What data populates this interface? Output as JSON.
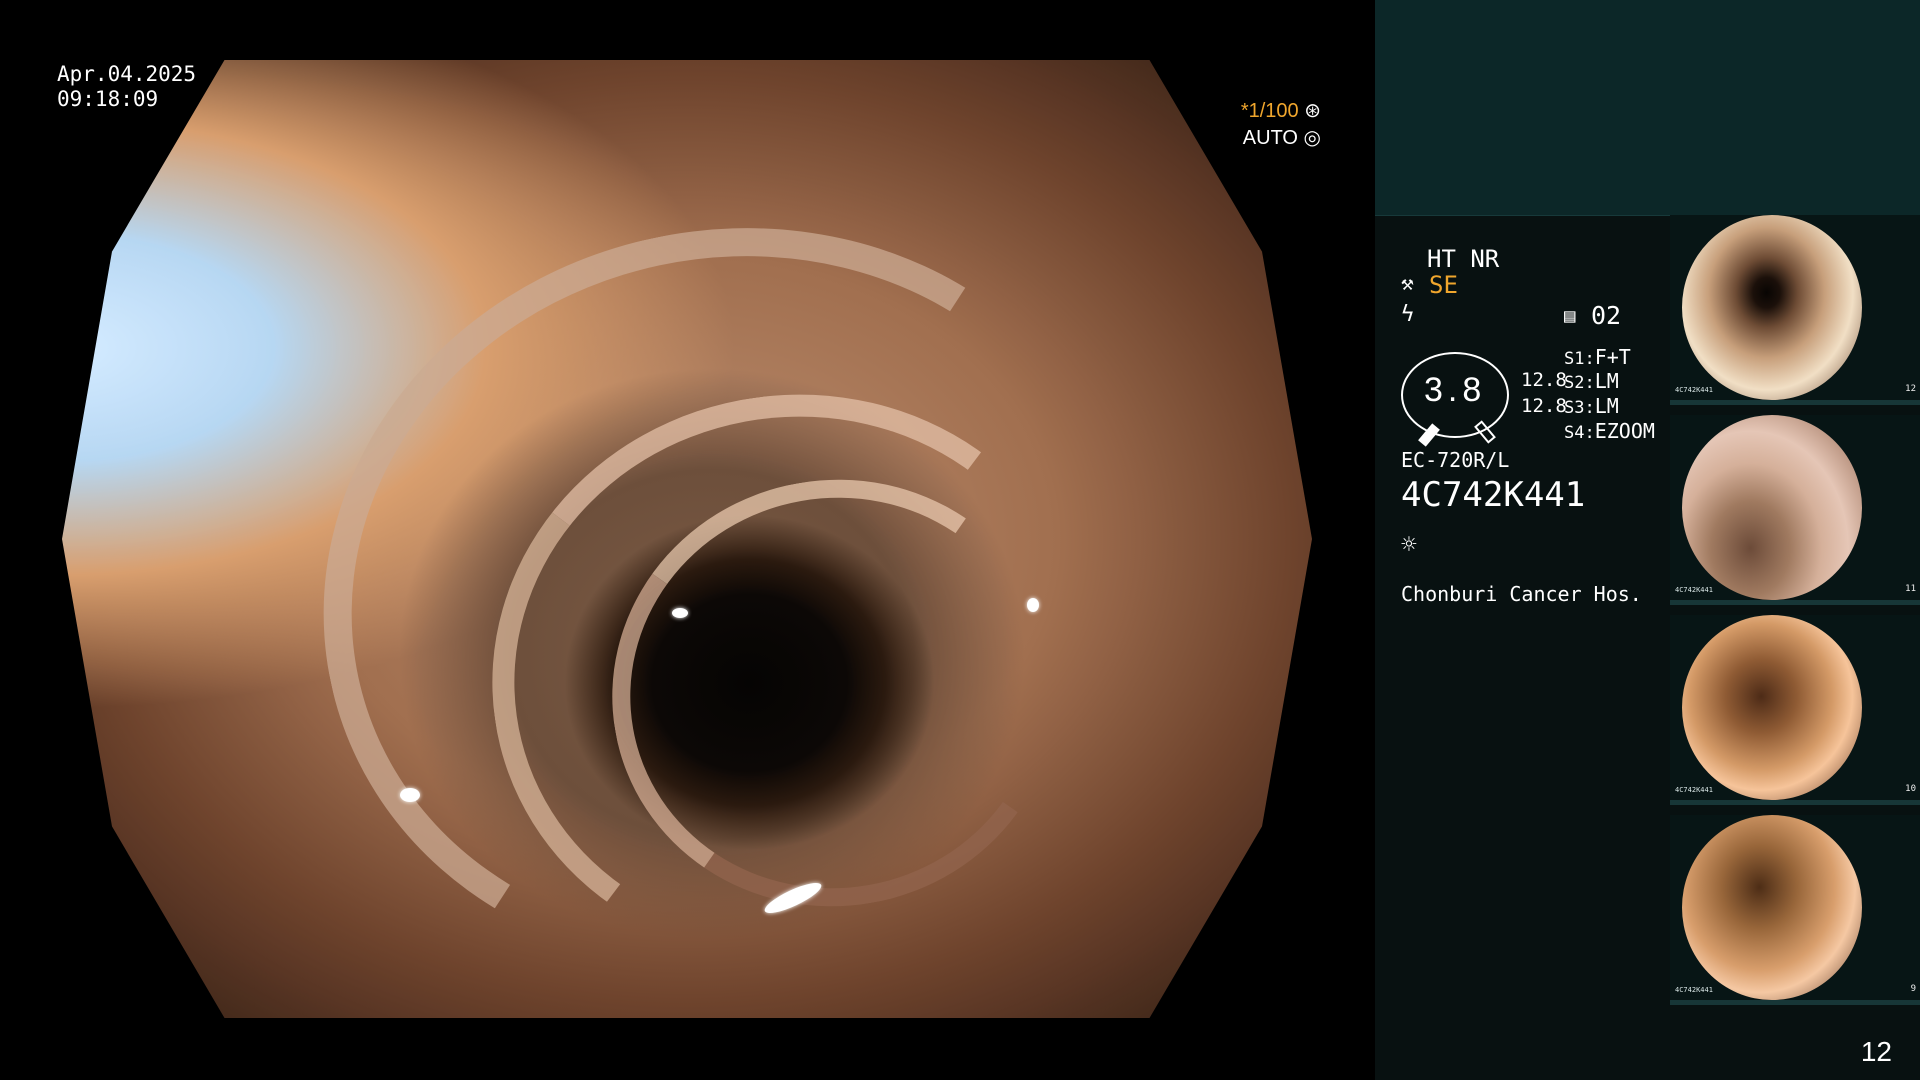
{
  "main": {
    "date": "Apr.04.2025",
    "time": "09:18:09",
    "shutter": "*1/100",
    "mode": "AUTO"
  },
  "info": {
    "header": "HT NR",
    "se": "SE",
    "mark_text": "02",
    "zoom": "3.8",
    "values": [
      "12.8",
      "12.8"
    ],
    "settings": [
      {
        "key": "S1:",
        "value": "F+T"
      },
      {
        "key": "S2:",
        "value": "LM"
      },
      {
        "key": "S3:",
        "value": "LM"
      },
      {
        "key": "S4:",
        "value": "EZOOM"
      }
    ],
    "model": "EC-720R/L",
    "id": "4C742K441",
    "location": "Chonburi Cancer Hos."
  },
  "thumbs": [
    {
      "id": "4C742K441",
      "number": "12"
    },
    {
      "id": "4C742K441",
      "number": "11"
    },
    {
      "id": "4C742K441",
      "number": "10"
    },
    {
      "id": "4C742K441",
      "number": "9"
    }
  ],
  "page_number": "12",
  "icons": [
    "wrench-icon",
    "flash-icon",
    "settings-icon",
    "light-icon"
  ]
}
